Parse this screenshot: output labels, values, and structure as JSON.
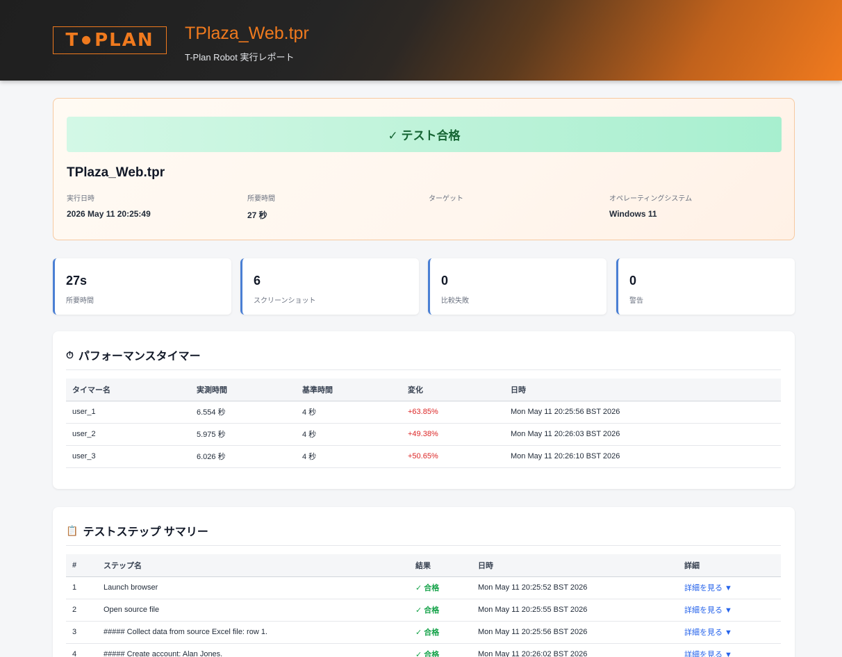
{
  "header": {
    "logo_text": "T·PLAN",
    "logo_left": "T",
    "logo_right": "PLAN",
    "title": "TPlaza_Web.tpr",
    "subtitle": "T-Plan Robot 実行レポート"
  },
  "result": {
    "banner": "✓ テスト合格",
    "name": "TPlaza_Web.tpr",
    "meta": [
      {
        "label": "実行日時",
        "value": "2026 May 11 20:25:49"
      },
      {
        "label": "所要時間",
        "value": "27 秒"
      },
      {
        "label": "ターゲット",
        "value": ""
      },
      {
        "label": "オペレーティングシステム",
        "value": "Windows 11"
      }
    ]
  },
  "stats": [
    {
      "value": "27s",
      "label": "所要時間"
    },
    {
      "value": "6",
      "label": "スクリーンショット"
    },
    {
      "value": "0",
      "label": "比較失敗"
    },
    {
      "value": "0",
      "label": "警告"
    }
  ],
  "timers": {
    "icon": "stopwatch-icon",
    "title": "パフォーマンスタイマー",
    "columns": [
      "タイマー名",
      "実測時間",
      "基準時間",
      "変化",
      "日時"
    ],
    "rows": [
      {
        "name": "user_1",
        "actual": "6.554 秒",
        "base": "4 秒",
        "change": "+63.85%",
        "date": "Mon May 11 20:25:56 BST 2026"
      },
      {
        "name": "user_2",
        "actual": "5.975 秒",
        "base": "4 秒",
        "change": "+49.38%",
        "date": "Mon May 11 20:26:03 BST 2026"
      },
      {
        "name": "user_3",
        "actual": "6.026 秒",
        "base": "4 秒",
        "change": "+50.65%",
        "date": "Mon May 11 20:26:10 BST 2026"
      }
    ]
  },
  "steps": {
    "icon": "clipboard-icon",
    "title": "テストステップ サマリー",
    "columns": [
      "#",
      "ステップ名",
      "結果",
      "日時",
      "詳細"
    ],
    "rows": [
      {
        "num": "1",
        "name": "Launch browser",
        "result": "✓ 合格",
        "date": "Mon May 11 20:25:52 BST 2026",
        "detail": "詳細を見る ▼"
      },
      {
        "num": "2",
        "name": "Open source file",
        "result": "✓ 合格",
        "date": "Mon May 11 20:25:55 BST 2026",
        "detail": "詳細を見る ▼"
      },
      {
        "num": "3",
        "name": "##### Collect data from source Excel file: row 1.",
        "result": "✓ 合格",
        "date": "Mon May 11 20:25:56 BST 2026",
        "detail": "詳細を見る ▼"
      },
      {
        "num": "4",
        "name": "##### Create account: Alan Jones.",
        "result": "✓ 合格",
        "date": "Mon May 11 20:26:02 BST 2026",
        "detail": "詳細を見る ▼"
      }
    ]
  },
  "colors": {
    "accent": "#f07a1e",
    "pass": "#16a34a",
    "fail_change": "#dc2626",
    "stat_border": "#4a7fd4"
  }
}
